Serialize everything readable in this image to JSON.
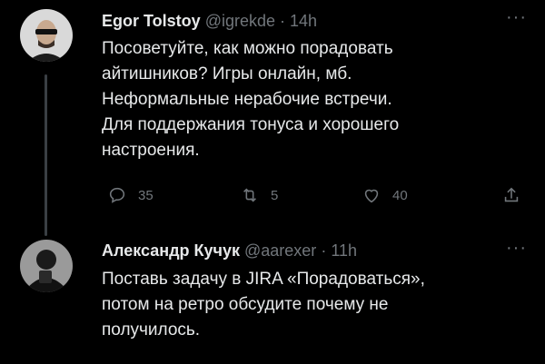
{
  "tweet1": {
    "name": "Egor Tolstoy",
    "handle": "@igrekde",
    "separator": "·",
    "time": "14h",
    "lines": [
      "Посоветуйте, как можно порадовать",
      "айтишников? Игры онлайн, мб.",
      "Неформальные нерабочие встречи.",
      "Для поддержания тонуса и хорошего",
      "настроения."
    ],
    "more_label": "···",
    "actions": {
      "reply_count": "35",
      "retweet_count": "5",
      "like_count": "40"
    }
  },
  "tweet2": {
    "name": "Александр Кучук",
    "handle": "@aarexer",
    "separator": "·",
    "time": "11h",
    "lines": [
      "Поставь задачу в JIRA «Порадоваться»,",
      "потом на ретро обсудите почему не",
      "получилось."
    ],
    "more_label": "···"
  },
  "icons": {
    "reply": "reply-icon",
    "retweet": "retweet-icon",
    "like": "heart-icon",
    "share": "share-icon",
    "more": "more-icon"
  },
  "colors": {
    "background": "#000000",
    "text": "#e7e9ea",
    "secondary": "#71767b"
  }
}
